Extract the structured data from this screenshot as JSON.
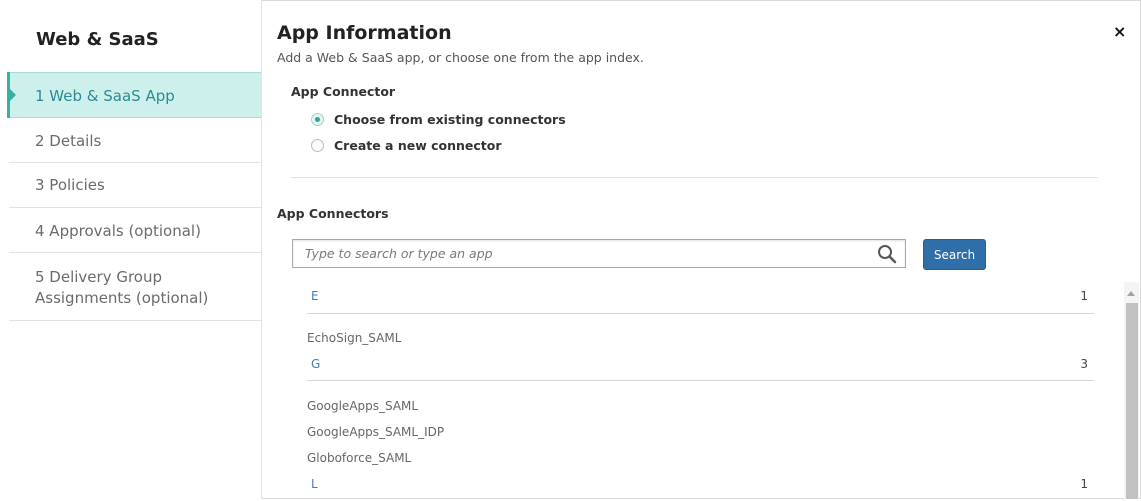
{
  "sidebar": {
    "title": "Web & SaaS",
    "steps": [
      {
        "label": "1 Web & SaaS App"
      },
      {
        "label": "2 Details"
      },
      {
        "label": "3 Policies"
      },
      {
        "label": "4 Approvals (optional)"
      },
      {
        "label": "5 Delivery Group Assignments (optional)"
      }
    ],
    "active_step": 1
  },
  "header": {
    "title": "App Information",
    "subtitle": "Add a Web & SaaS app, or choose one from the app index.",
    "close_label": "×"
  },
  "connector": {
    "label": "App Connector",
    "options": [
      {
        "label": "Choose from existing connectors",
        "selected": true
      },
      {
        "label": "Create a new connector",
        "selected": false
      }
    ]
  },
  "connectors": {
    "label": "App Connectors",
    "search_placeholder": "Type to search or type an app",
    "search_value": "",
    "search_button": "Search",
    "groups": [
      {
        "letter": "E",
        "count": "1",
        "items": [
          "EchoSign_SAML"
        ]
      },
      {
        "letter": "G",
        "count": "3",
        "items": [
          "GoogleApps_SAML",
          "GoogleApps_SAML_IDP",
          "Globoforce_SAML"
        ]
      },
      {
        "letter": "L",
        "count": "1",
        "items": []
      }
    ]
  },
  "colors": {
    "accent": "#37b0a4",
    "active_bg": "#cdf0ec",
    "active_text": "#2d8a93",
    "button": "#2f6fa9",
    "letter": "#3f7fc0"
  },
  "icons": {
    "search": "search-icon",
    "close": "close-icon"
  }
}
